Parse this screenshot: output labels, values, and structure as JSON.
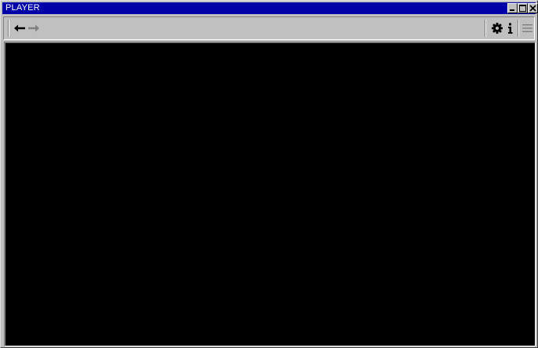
{
  "window": {
    "title": "PLAYER"
  },
  "titlebar_buttons": {
    "minimize": "minimize-icon",
    "maximize": "maximize-icon",
    "close": "close-icon"
  },
  "toolbar": {
    "back_icon": "arrow-left-icon",
    "forward_icon": "arrow-right-icon",
    "settings_icon": "gear-icon",
    "info_icon": "info-icon",
    "menu_icon": "hamburger-menu-icon"
  },
  "colors": {
    "titlebar": "#0000a8",
    "chrome": "#c0c0c0",
    "video_background": "#000000",
    "icon_active": "#000000",
    "icon_disabled": "#808080"
  }
}
